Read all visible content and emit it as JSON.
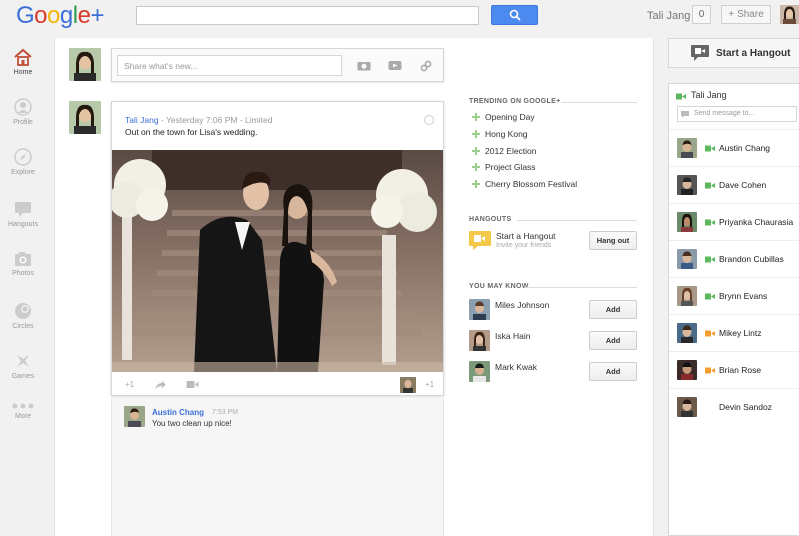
{
  "app": {
    "logo": "Google+",
    "search": {
      "placeholder": ""
    },
    "user_name": "Tali Jang",
    "notification_count": "0",
    "share_label": "Share"
  },
  "nav": [
    {
      "id": "home",
      "label": "Home",
      "active": true
    },
    {
      "id": "profile",
      "label": "Profile"
    },
    {
      "id": "explore",
      "label": "Explore"
    },
    {
      "id": "hangouts",
      "label": "Hangouts"
    },
    {
      "id": "photos",
      "label": "Photos"
    },
    {
      "id": "circles",
      "label": "Circles"
    },
    {
      "id": "games",
      "label": "Games"
    },
    {
      "id": "more",
      "label": "More"
    }
  ],
  "sharebox": {
    "placeholder": "Share what's new..."
  },
  "post": {
    "author": "Tali Jang",
    "meta": " - Yesterday 7:06 PM - Limited",
    "text": "Out on the town for Lisa's wedding.",
    "plus_one": "+1",
    "plus_count": "+1"
  },
  "comment": {
    "author": "Austin Chang",
    "time": "7:53 PM",
    "text": "You two clean up nice!"
  },
  "trending": {
    "title": "TRENDING ON GOOGLE+",
    "items": [
      "Opening Day",
      "Hong Kong",
      "2012 Election",
      "Project Glass",
      "Cherry Blossom Festival"
    ]
  },
  "hangouts": {
    "title": "HANGOUTS",
    "start": "Start a Hangout",
    "invite": "Invite your friends",
    "button": "Hang out"
  },
  "people": {
    "title": "YOU MAY KNOW",
    "add_label": "Add",
    "items": [
      "Miles Johnson",
      "Iska Hain",
      "Mark Kwak"
    ]
  },
  "chat": {
    "start_hangout": "Start a Hangout",
    "me": "Tali Jang",
    "message_placeholder": "Send message to...",
    "contacts": [
      {
        "name": "Austin Chang",
        "status": "green"
      },
      {
        "name": "Dave Cohen",
        "status": "green"
      },
      {
        "name": "Priyanka Chaurasia",
        "status": "green"
      },
      {
        "name": "Brandon Cubillas",
        "status": "green"
      },
      {
        "name": "Brynn Evans",
        "status": "green"
      },
      {
        "name": "Mikey Lintz",
        "status": "orange"
      },
      {
        "name": "Brian Rose",
        "status": "orange"
      },
      {
        "name": "Devin Sandoz",
        "status": "none"
      }
    ]
  },
  "colors": {
    "accent": "#4d8af0",
    "link": "#3a6fd8",
    "online": "#5cb85c",
    "idle": "#f0a030"
  }
}
